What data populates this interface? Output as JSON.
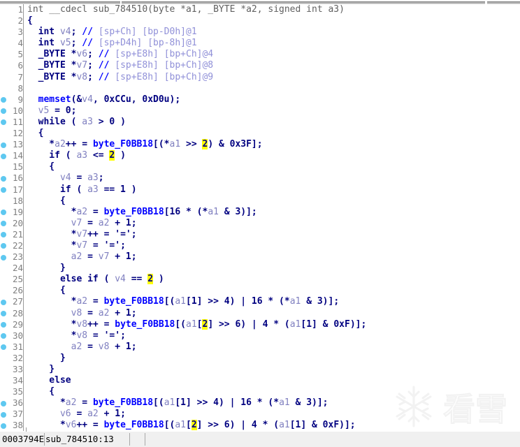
{
  "window": {
    "title": "IDA Pseudocode",
    "view_type": "pseudocode-decompiler"
  },
  "statusbar": {
    "address": "0003794E",
    "location": "sub_784510:13",
    "extra": ""
  },
  "watermark": {
    "text": "看雪",
    "icon": "snowflake-icon"
  },
  "colors": {
    "background": "#ffffff",
    "keyword": "#000080",
    "global_name": "#0000ff",
    "local_var": "#8080c0",
    "comment": "#9090d8",
    "unfocused": "#606060",
    "highlight_bg": "#ffff00",
    "gutter_text": "#808080",
    "breakpoint_dot": "#5ec8f0",
    "statusbar_bg": "#f0f0f0"
  },
  "code": {
    "first_line": 1,
    "last_line": 38,
    "breakpoint_lines": [
      9,
      10,
      11,
      13,
      14,
      16,
      17,
      19,
      20,
      21,
      22,
      23,
      27,
      28,
      29,
      30,
      31,
      36,
      37,
      38
    ],
    "lines": [
      {
        "n": 1,
        "tokens": [
          {
            "t": "int __cdecl sub_784510(byte *a1, _BYTE *a2, signed int a3)",
            "c": "gr"
          }
        ]
      },
      {
        "n": 2,
        "tokens": [
          {
            "t": "{",
            "c": "k"
          }
        ]
      },
      {
        "n": 3,
        "tokens": [
          {
            "t": "  ",
            "c": "k"
          },
          {
            "t": "int ",
            "c": "k"
          },
          {
            "t": "v4",
            "c": "lv"
          },
          {
            "t": "; ",
            "c": "k"
          },
          {
            "t": "// ",
            "c": "id"
          },
          {
            "t": "[sp+Ch] [bp-D0h]@1",
            "c": "cm"
          }
        ]
      },
      {
        "n": 4,
        "tokens": [
          {
            "t": "  ",
            "c": "k"
          },
          {
            "t": "int ",
            "c": "k"
          },
          {
            "t": "v5",
            "c": "lv"
          },
          {
            "t": "; ",
            "c": "k"
          },
          {
            "t": "// ",
            "c": "id"
          },
          {
            "t": "[sp+D4h] [bp-8h]@1",
            "c": "cm"
          }
        ]
      },
      {
        "n": 5,
        "tokens": [
          {
            "t": "  _BYTE *",
            "c": "k"
          },
          {
            "t": "v6",
            "c": "lv"
          },
          {
            "t": "; ",
            "c": "k"
          },
          {
            "t": "// ",
            "c": "id"
          },
          {
            "t": "[sp+E8h] [bp+Ch]@4",
            "c": "cm"
          }
        ]
      },
      {
        "n": 6,
        "tokens": [
          {
            "t": "  _BYTE *",
            "c": "k"
          },
          {
            "t": "v7",
            "c": "lv"
          },
          {
            "t": "; ",
            "c": "k"
          },
          {
            "t": "// ",
            "c": "id"
          },
          {
            "t": "[sp+E8h] [bp+Ch]@8",
            "c": "cm"
          }
        ]
      },
      {
        "n": 7,
        "tokens": [
          {
            "t": "  _BYTE *",
            "c": "k"
          },
          {
            "t": "v8",
            "c": "lv"
          },
          {
            "t": "; ",
            "c": "k"
          },
          {
            "t": "// ",
            "c": "id"
          },
          {
            "t": "[sp+E8h] [bp+Ch]@9",
            "c": "cm"
          }
        ]
      },
      {
        "n": 8,
        "tokens": [
          {
            "t": "",
            "c": "k"
          }
        ]
      },
      {
        "n": 9,
        "tokens": [
          {
            "t": "  ",
            "c": "k"
          },
          {
            "t": "memset",
            "c": "id"
          },
          {
            "t": "(&",
            "c": "k"
          },
          {
            "t": "v4",
            "c": "lv"
          },
          {
            "t": ", 0xCCu, 0xD0u);",
            "c": "k"
          }
        ]
      },
      {
        "n": 10,
        "tokens": [
          {
            "t": "  ",
            "c": "k"
          },
          {
            "t": "v5",
            "c": "lv"
          },
          {
            "t": " = 0;",
            "c": "k"
          }
        ]
      },
      {
        "n": 11,
        "tokens": [
          {
            "t": "  while ( ",
            "c": "k"
          },
          {
            "t": "a3",
            "c": "lv"
          },
          {
            "t": " > 0 )",
            "c": "k"
          }
        ]
      },
      {
        "n": 12,
        "tokens": [
          {
            "t": "  {",
            "c": "k"
          }
        ]
      },
      {
        "n": 13,
        "tokens": [
          {
            "t": "    *",
            "c": "k"
          },
          {
            "t": "a2",
            "c": "lv"
          },
          {
            "t": "++ = ",
            "c": "k"
          },
          {
            "t": "byte_F0BB18",
            "c": "id"
          },
          {
            "t": "[(*",
            "c": "k"
          },
          {
            "t": "a1",
            "c": "lv"
          },
          {
            "t": " >> ",
            "c": "k"
          },
          {
            "t": "2",
            "c": "hl"
          },
          {
            "t": ") & 0x3F];",
            "c": "k"
          }
        ]
      },
      {
        "n": 14,
        "tokens": [
          {
            "t": "    if ( ",
            "c": "k"
          },
          {
            "t": "a3",
            "c": "lv"
          },
          {
            "t": " <= ",
            "c": "k"
          },
          {
            "t": "2",
            "c": "hl"
          },
          {
            "t": " )",
            "c": "k"
          }
        ]
      },
      {
        "n": 15,
        "tokens": [
          {
            "t": "    {",
            "c": "k"
          }
        ]
      },
      {
        "n": 16,
        "tokens": [
          {
            "t": "      ",
            "c": "k"
          },
          {
            "t": "v4",
            "c": "lv"
          },
          {
            "t": " = ",
            "c": "k"
          },
          {
            "t": "a3",
            "c": "lv"
          },
          {
            "t": ";",
            "c": "k"
          }
        ]
      },
      {
        "n": 17,
        "tokens": [
          {
            "t": "      if ( ",
            "c": "k"
          },
          {
            "t": "a3",
            "c": "lv"
          },
          {
            "t": " == 1 )",
            "c": "k"
          }
        ]
      },
      {
        "n": 18,
        "tokens": [
          {
            "t": "      {",
            "c": "k"
          }
        ]
      },
      {
        "n": 19,
        "tokens": [
          {
            "t": "        *",
            "c": "k"
          },
          {
            "t": "a2",
            "c": "lv"
          },
          {
            "t": " = ",
            "c": "k"
          },
          {
            "t": "byte_F0BB18",
            "c": "id"
          },
          {
            "t": "[16 * (*",
            "c": "k"
          },
          {
            "t": "a1",
            "c": "lv"
          },
          {
            "t": " & 3)];",
            "c": "k"
          }
        ]
      },
      {
        "n": 20,
        "tokens": [
          {
            "t": "        ",
            "c": "k"
          },
          {
            "t": "v7",
            "c": "lv"
          },
          {
            "t": " = ",
            "c": "k"
          },
          {
            "t": "a2",
            "c": "lv"
          },
          {
            "t": " + 1;",
            "c": "k"
          }
        ]
      },
      {
        "n": 21,
        "tokens": [
          {
            "t": "        *",
            "c": "k"
          },
          {
            "t": "v7",
            "c": "lv"
          },
          {
            "t": "++ = '=';",
            "c": "k"
          }
        ]
      },
      {
        "n": 22,
        "tokens": [
          {
            "t": "        *",
            "c": "k"
          },
          {
            "t": "v7",
            "c": "lv"
          },
          {
            "t": " = '=';",
            "c": "k"
          }
        ]
      },
      {
        "n": 23,
        "tokens": [
          {
            "t": "        ",
            "c": "k"
          },
          {
            "t": "a2",
            "c": "lv"
          },
          {
            "t": " = ",
            "c": "k"
          },
          {
            "t": "v7",
            "c": "lv"
          },
          {
            "t": " + 1;",
            "c": "k"
          }
        ]
      },
      {
        "n": 24,
        "tokens": [
          {
            "t": "      }",
            "c": "k"
          }
        ]
      },
      {
        "n": 25,
        "tokens": [
          {
            "t": "      else if ( ",
            "c": "k"
          },
          {
            "t": "v4",
            "c": "lv"
          },
          {
            "t": " == ",
            "c": "k"
          },
          {
            "t": "2",
            "c": "hl"
          },
          {
            "t": " )",
            "c": "k"
          }
        ]
      },
      {
        "n": 26,
        "tokens": [
          {
            "t": "      {",
            "c": "k"
          }
        ]
      },
      {
        "n": 27,
        "tokens": [
          {
            "t": "        *",
            "c": "k"
          },
          {
            "t": "a2",
            "c": "lv"
          },
          {
            "t": " = ",
            "c": "k"
          },
          {
            "t": "byte_F0BB18",
            "c": "id"
          },
          {
            "t": "[(",
            "c": "k"
          },
          {
            "t": "a1",
            "c": "lv"
          },
          {
            "t": "[1] >> 4) | 16 * (*",
            "c": "k"
          },
          {
            "t": "a1",
            "c": "lv"
          },
          {
            "t": " & 3)];",
            "c": "k"
          }
        ]
      },
      {
        "n": 28,
        "tokens": [
          {
            "t": "        ",
            "c": "k"
          },
          {
            "t": "v8",
            "c": "lv"
          },
          {
            "t": " = ",
            "c": "k"
          },
          {
            "t": "a2",
            "c": "lv"
          },
          {
            "t": " + 1;",
            "c": "k"
          }
        ]
      },
      {
        "n": 29,
        "tokens": [
          {
            "t": "        *",
            "c": "k"
          },
          {
            "t": "v8",
            "c": "lv"
          },
          {
            "t": "++ = ",
            "c": "k"
          },
          {
            "t": "byte_F0BB18",
            "c": "id"
          },
          {
            "t": "[(",
            "c": "k"
          },
          {
            "t": "a1",
            "c": "lv"
          },
          {
            "t": "[",
            "c": "k"
          },
          {
            "t": "2",
            "c": "hl"
          },
          {
            "t": "] >> 6) | 4 * (",
            "c": "k"
          },
          {
            "t": "a1",
            "c": "lv"
          },
          {
            "t": "[1] & 0xF)];",
            "c": "k"
          }
        ]
      },
      {
        "n": 30,
        "tokens": [
          {
            "t": "        *",
            "c": "k"
          },
          {
            "t": "v8",
            "c": "lv"
          },
          {
            "t": " = '=';",
            "c": "k"
          }
        ]
      },
      {
        "n": 31,
        "tokens": [
          {
            "t": "        ",
            "c": "k"
          },
          {
            "t": "a2",
            "c": "lv"
          },
          {
            "t": " = ",
            "c": "k"
          },
          {
            "t": "v8",
            "c": "lv"
          },
          {
            "t": " + 1;",
            "c": "k"
          }
        ]
      },
      {
        "n": 32,
        "tokens": [
          {
            "t": "      }",
            "c": "k"
          }
        ]
      },
      {
        "n": 33,
        "tokens": [
          {
            "t": "    }",
            "c": "k"
          }
        ]
      },
      {
        "n": 34,
        "tokens": [
          {
            "t": "    else",
            "c": "k"
          }
        ]
      },
      {
        "n": 35,
        "tokens": [
          {
            "t": "    {",
            "c": "k"
          }
        ]
      },
      {
        "n": 36,
        "tokens": [
          {
            "t": "      *",
            "c": "k"
          },
          {
            "t": "a2",
            "c": "lv"
          },
          {
            "t": " = ",
            "c": "k"
          },
          {
            "t": "byte_F0BB18",
            "c": "id"
          },
          {
            "t": "[(",
            "c": "k"
          },
          {
            "t": "a1",
            "c": "lv"
          },
          {
            "t": "[1] >> 4) | 16 * (*",
            "c": "k"
          },
          {
            "t": "a1",
            "c": "lv"
          },
          {
            "t": " & 3)];",
            "c": "k"
          }
        ]
      },
      {
        "n": 37,
        "tokens": [
          {
            "t": "      ",
            "c": "k"
          },
          {
            "t": "v6",
            "c": "lv"
          },
          {
            "t": " = ",
            "c": "k"
          },
          {
            "t": "a2",
            "c": "lv"
          },
          {
            "t": " + 1;",
            "c": "k"
          }
        ]
      },
      {
        "n": 38,
        "tokens": [
          {
            "t": "      *",
            "c": "k"
          },
          {
            "t": "v6",
            "c": "lv"
          },
          {
            "t": "++ = ",
            "c": "k"
          },
          {
            "t": "byte_F0BB18",
            "c": "id"
          },
          {
            "t": "[(",
            "c": "k"
          },
          {
            "t": "a1",
            "c": "lv"
          },
          {
            "t": "[",
            "c": "k"
          },
          {
            "t": "2",
            "c": "hl"
          },
          {
            "t": "] >> 6) | 4 * (",
            "c": "k"
          },
          {
            "t": "a1",
            "c": "lv"
          },
          {
            "t": "[1] & 0xF)];",
            "c": "k"
          }
        ]
      }
    ]
  }
}
